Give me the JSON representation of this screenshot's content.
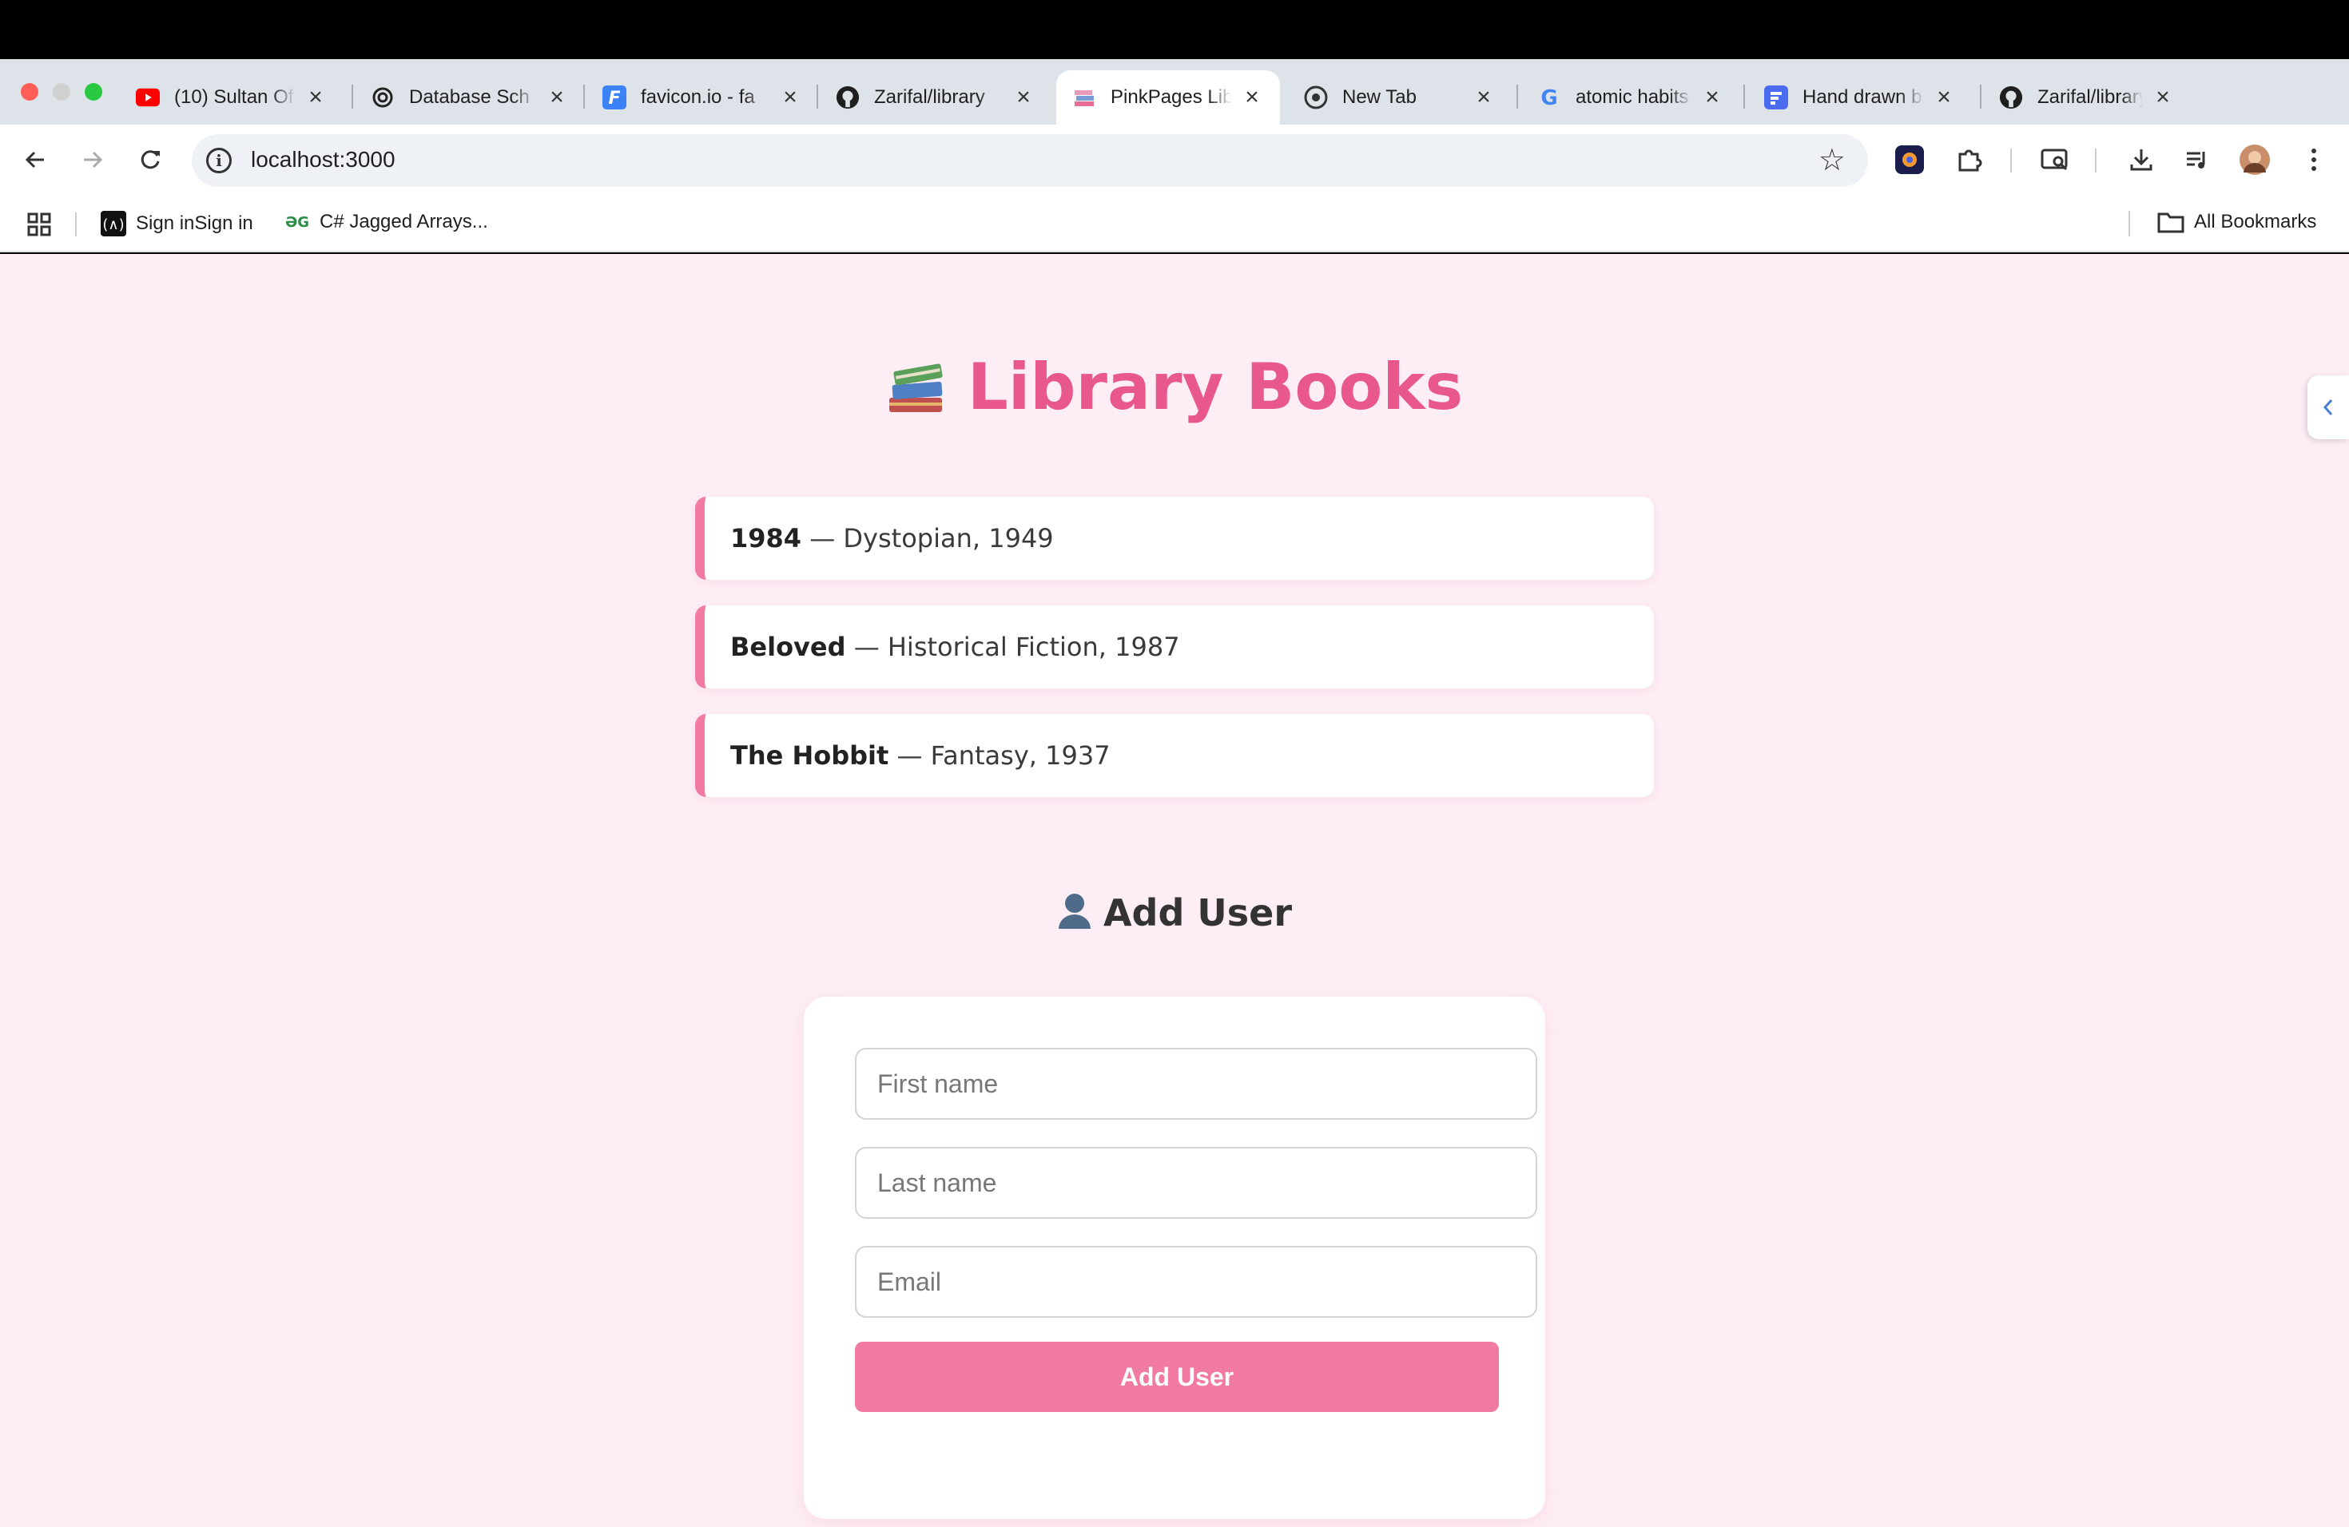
{
  "browser": {
    "tabs": [
      {
        "title": "(10) Sultan Of",
        "favicon": "youtube-icon",
        "active": false
      },
      {
        "title": "Database Sch",
        "favicon": "openai-icon",
        "active": false
      },
      {
        "title": "favicon.io - fa",
        "favicon": "favicon-io-icon",
        "active": false
      },
      {
        "title": "Zarifal/library",
        "favicon": "github-icon",
        "active": false
      },
      {
        "title": "PinkPages Lib",
        "favicon": "books-icon",
        "active": true
      },
      {
        "title": "New Tab",
        "favicon": "chrome-icon",
        "active": false
      },
      {
        "title": "atomic habits",
        "favicon": "google-icon",
        "active": false
      },
      {
        "title": "Hand drawn b",
        "favicon": "doc-icon",
        "active": false
      },
      {
        "title": "Zarifal/library",
        "favicon": "github-icon",
        "active": false
      }
    ],
    "new_tab_label": "+",
    "tab_close_label": "×",
    "url": "localhost:3000",
    "bookmarks": [
      {
        "label": "Sign inSign in",
        "icon": "appwrite-icon"
      },
      {
        "label": "C# Jagged Arrays...",
        "icon": "geeksforgeeks-icon"
      }
    ],
    "all_bookmarks_label": "All Bookmarks"
  },
  "page": {
    "title": "Library Books",
    "books": [
      {
        "title": "1984",
        "details": " — Dystopian, 1949"
      },
      {
        "title": "Beloved",
        "details": " — Historical Fiction, 1987"
      },
      {
        "title": "The Hobbit",
        "details": " — Fantasy, 1937"
      }
    ],
    "add_user_heading": "Add User",
    "form": {
      "first_name_placeholder": "First name",
      "last_name_placeholder": "Last name",
      "email_placeholder": "Email",
      "submit_label": "Add User"
    }
  },
  "colors": {
    "accent": "#e8588c",
    "button": "#f07aa1",
    "page_background": "#fdeef5"
  }
}
